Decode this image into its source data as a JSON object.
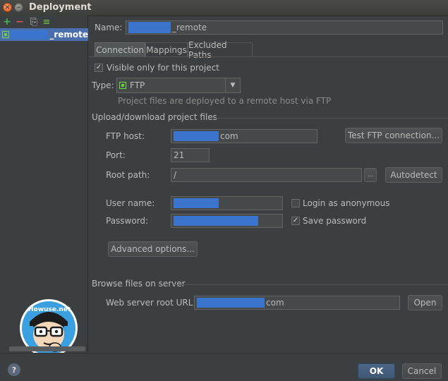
{
  "window": {
    "title": "Deployment"
  },
  "icons": {
    "close": "×",
    "minimize": "–",
    "add": "+",
    "remove": "−",
    "copy": "⎘",
    "import": "≡",
    "check": "✓",
    "dropdown": "▼",
    "help": "?"
  },
  "colors": {
    "accent": "#4b6eaf",
    "redaction": "#3a74cc",
    "add_green": "#4caf50",
    "remove_red": "#d9534f"
  },
  "tree": {
    "selected_suffix": "_remote"
  },
  "form": {
    "name_label": "Name:",
    "name_suffix": "_remote",
    "tabs": [
      "Connection",
      "Mappings",
      "Excluded Paths"
    ],
    "visible_only": "Visible only for this project",
    "type_label": "Type:",
    "type_value": "FTP",
    "type_hint": "Project files are deployed to a remote host via FTP",
    "section_upload": "Upload/download project files",
    "ftp_host_label": "FTP host:",
    "ftp_host_suffix": "com",
    "test_button": "Test FTP connection...",
    "port_label": "Port:",
    "port_value": "21",
    "root_path_label": "Root path:",
    "root_path_value": "/",
    "browse_dots": "...",
    "autodetect_button": "Autodetect",
    "username_label": "User name:",
    "login_anonymous": "Login as anonymous",
    "password_label": "Password:",
    "save_password": "Save password",
    "advanced_button": "Advanced options...",
    "section_browse": "Browse files on server",
    "web_root_label": "Web server root URL:",
    "web_root_suffix": "com",
    "open_button": "Open"
  },
  "footer": {
    "ok": "OK",
    "cancel": "Cancel"
  },
  "watermark": {
    "text": "Howuse.net"
  }
}
